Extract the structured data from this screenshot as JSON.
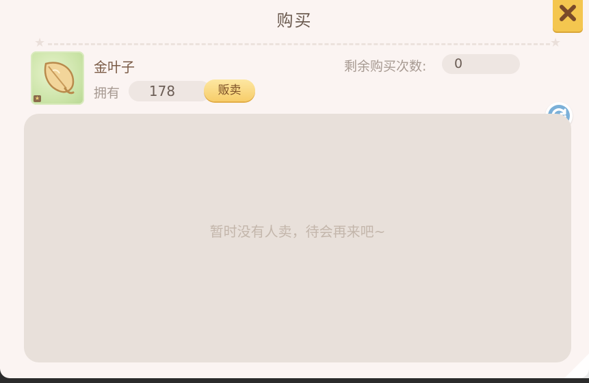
{
  "dialog": {
    "title": "购买",
    "close_icon": "close-icon"
  },
  "item": {
    "name": "金叶子",
    "icon": "golden-leaf-icon",
    "own_label": "拥有",
    "own_count": "178",
    "sell_label": "贩卖"
  },
  "purchase": {
    "remaining_label": "剩余购买次数:",
    "remaining_count": "0"
  },
  "refresh": {
    "icon": "refresh-icon"
  },
  "listing": {
    "empty_message": "暂时没有人卖，待会再来吧~"
  },
  "colors": {
    "panel_bg": "#fbf4f2",
    "list_bg": "#e8e0da",
    "accent_yellow": "#f4c64f",
    "refresh_blue": "#6fa3cf"
  }
}
